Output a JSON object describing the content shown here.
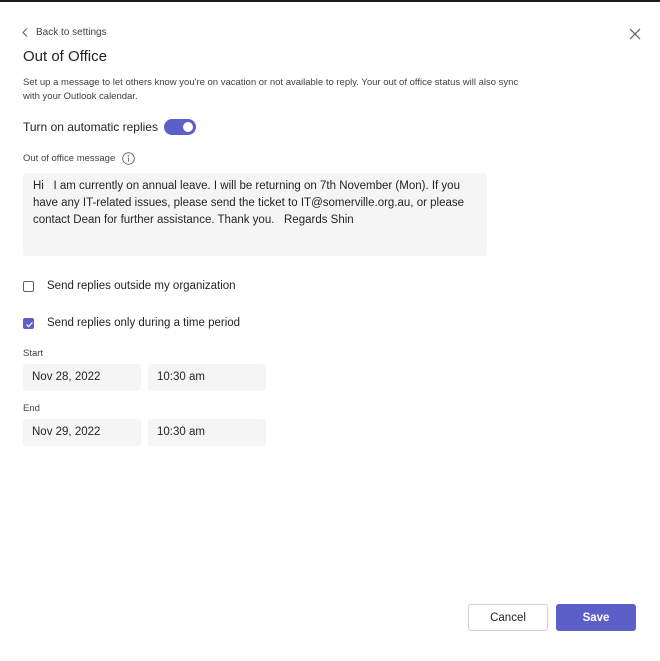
{
  "header": {
    "back_label": "Back to settings",
    "title": "Out of Office",
    "description": "Set up a message to let others know you're on vacation or not available to reply. Your out of office status will also sync with your Outlook calendar."
  },
  "auto_replies": {
    "label": "Turn on automatic replies",
    "enabled": true
  },
  "message": {
    "label": "Out of office message",
    "text": "Hi   I am currently on annual leave. I will be returning on 7th November (Mon). If you have any IT-related issues, please send the ticket to IT@somerville.org.au, or please contact Dean for further assistance. Thank you.   Regards Shin"
  },
  "options": {
    "outside_org": {
      "label": "Send replies outside my organization",
      "checked": false
    },
    "time_period": {
      "label": "Send replies only during a time period",
      "checked": true
    }
  },
  "schedule": {
    "start": {
      "label": "Start",
      "date": "Nov 28, 2022",
      "time": "10:30 am"
    },
    "end": {
      "label": "End",
      "date": "Nov 29, 2022",
      "time": "10:30 am"
    }
  },
  "footer": {
    "cancel_label": "Cancel",
    "save_label": "Save"
  },
  "colors": {
    "accent": "#5b5fc7",
    "field_background": "#f5f5f5",
    "text": "#242424"
  },
  "icons": {
    "back": "chevron-left-icon",
    "close": "close-icon",
    "info": "info-icon",
    "check": "checkmark-icon"
  }
}
